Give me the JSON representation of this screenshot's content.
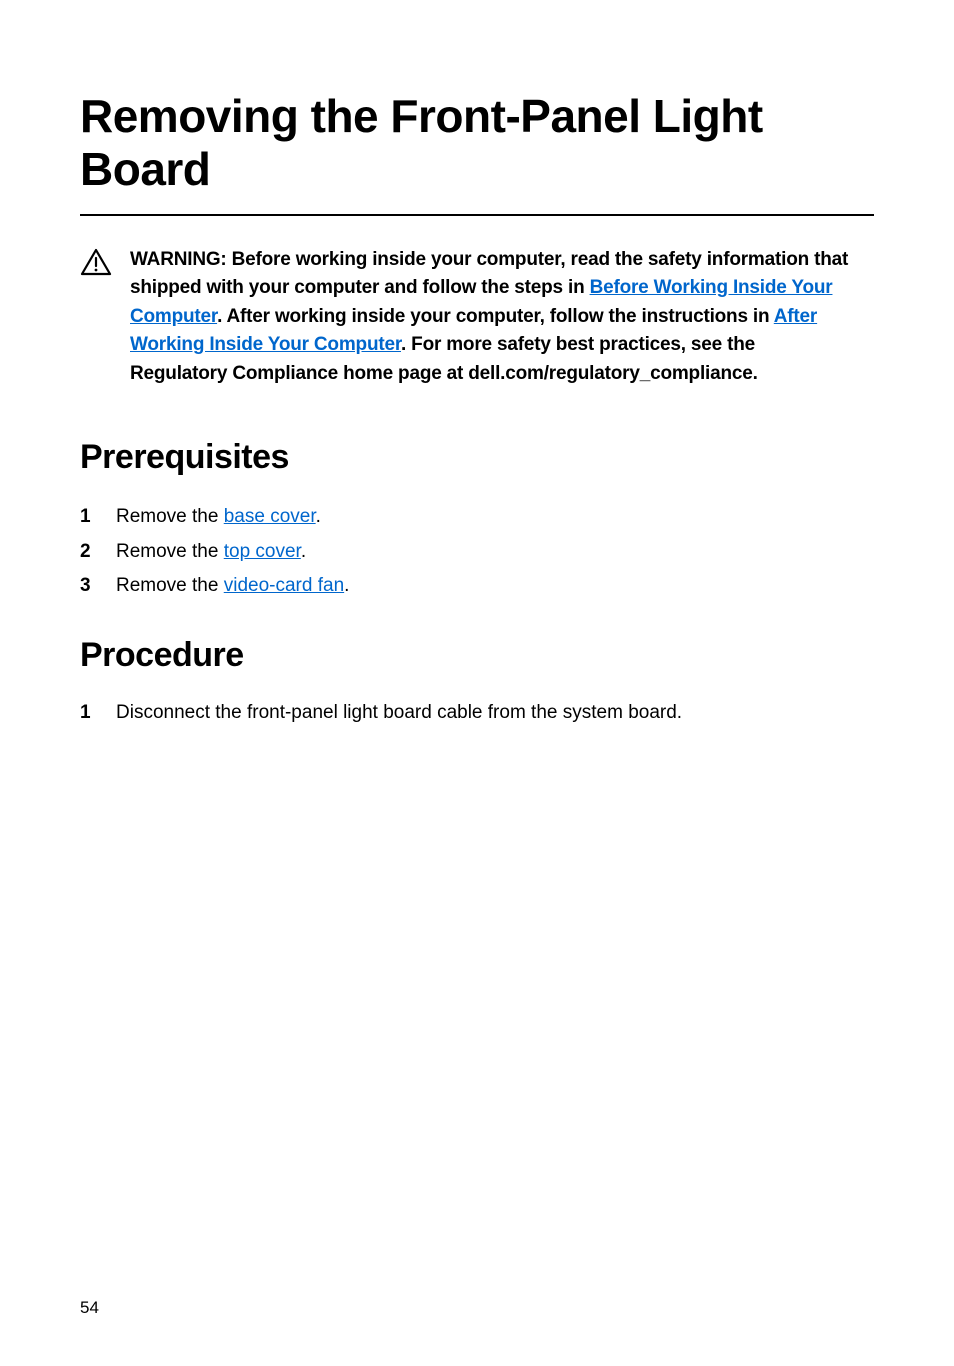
{
  "page": {
    "title": "Removing the Front-Panel Light Board",
    "pageNumber": "54"
  },
  "warning": {
    "prefix": "WARNING: Before working inside your computer, read the safety information that shipped with your computer and follow the steps in ",
    "link1": "Before Working Inside Your Computer",
    "mid1": ". After working inside your computer, follow the instructions in ",
    "link2": "After Working Inside Your Computer",
    "suffix": ". For more safety best practices, see the Regulatory Compliance home page at dell.com/regulatory_compliance."
  },
  "sections": {
    "prerequisites": {
      "title": "Prerequisites",
      "items": [
        {
          "prefix": "Remove the ",
          "link": "base cover",
          "suffix": "."
        },
        {
          "prefix": "Remove the ",
          "link": "top cover",
          "suffix": "."
        },
        {
          "prefix": "Remove the ",
          "link": "video-card fan",
          "suffix": "."
        }
      ]
    },
    "procedure": {
      "title": "Procedure",
      "items": [
        {
          "text": "Disconnect the front-panel light board cable from the system board."
        }
      ]
    }
  }
}
